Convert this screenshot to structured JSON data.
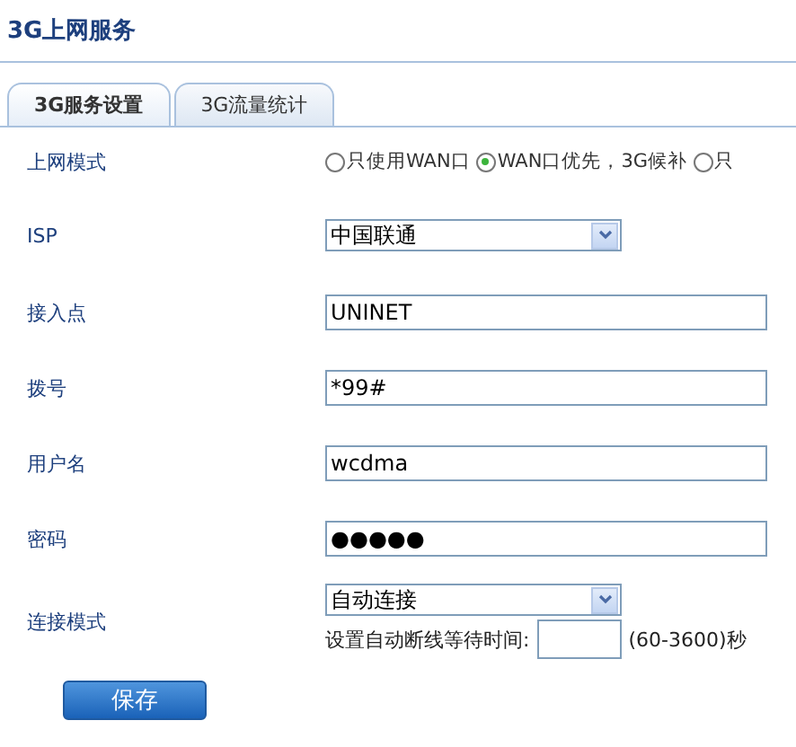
{
  "page_title": "3G上网服务",
  "tabs": [
    {
      "label": "3G服务设置",
      "selected": true
    },
    {
      "label": "3G流量统计",
      "selected": false
    }
  ],
  "form": {
    "rows": [
      {
        "kind": "radios",
        "label": "上网模式",
        "options": [
          {
            "label": "只使用WAN口",
            "selected": false
          },
          {
            "label": "WAN口优先，3G候补",
            "selected": true
          },
          {
            "label": "只",
            "selected": false
          }
        ]
      },
      {
        "kind": "select",
        "label": "ISP",
        "value": "中国联通"
      },
      {
        "kind": "text",
        "label": "接入点",
        "value": "UNINET"
      },
      {
        "kind": "text",
        "label": "拨号",
        "value": "*99#"
      },
      {
        "kind": "text",
        "label": "用户名",
        "value": "wcdma"
      },
      {
        "kind": "password",
        "label": "密码",
        "value": "●●●●●"
      },
      {
        "kind": "select_timeout",
        "label": "连接模式",
        "value": "自动连接",
        "timeout_label": "设置自动断线等待时间:",
        "timeout_range": "(60-3600)秒"
      }
    ]
  },
  "save_button": "保存"
}
